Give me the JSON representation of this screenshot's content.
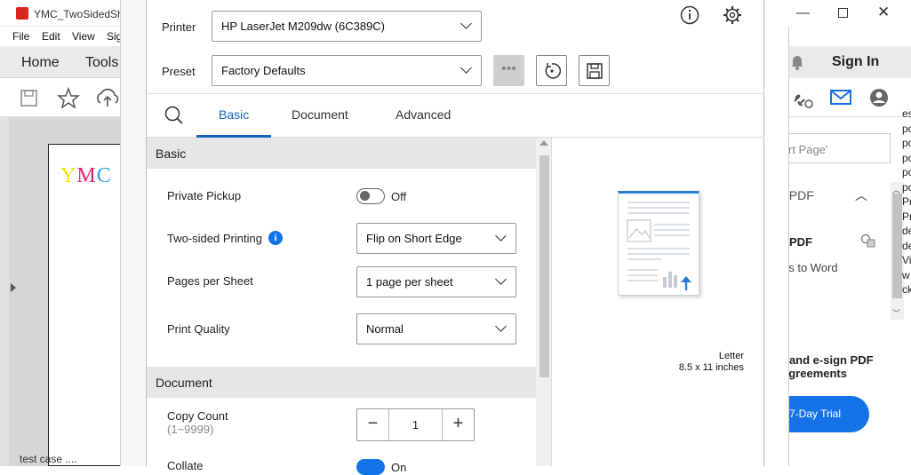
{
  "background_window": {
    "title": "YMC_TwoSidedSho",
    "menu": [
      "File",
      "Edit",
      "View",
      "Sig"
    ],
    "nav": {
      "home": "Home",
      "tools": "Tools"
    },
    "document_text": "YMC",
    "bottom_text": "test case ...."
  },
  "right_pane": {
    "signin": "Sign In",
    "search_placeholder": "rt Page'",
    "section_title": "t PDF",
    "tool_title": "t PDF",
    "tool_desc": "es to Word",
    "promo_line1": "t and e-sign PDF",
    "promo_line2": "agreements",
    "trial_button": "7-Day Trial",
    "list_chars": "es\npo\npo\npo\npo\npo\nPr\nPr\nde\nde\nVi\nw\nck"
  },
  "dialog": {
    "printer_label": "Printer",
    "printer_value": "HP LaserJet M209dw (6C389C)",
    "preset_label": "Preset",
    "preset_value": "Factory Defaults",
    "more_label": "•••",
    "tabs": {
      "basic": "Basic",
      "document": "Document",
      "advanced": "Advanced"
    },
    "basic_section": {
      "title": "Basic",
      "private_pickup": {
        "label": "Private Pickup",
        "state": "Off"
      },
      "two_sided": {
        "label": "Two-sided Printing",
        "value": "Flip on Short Edge"
      },
      "pages_per_sheet": {
        "label": "Pages per Sheet",
        "value": "1 page per sheet"
      },
      "print_quality": {
        "label": "Print Quality",
        "value": "Normal"
      }
    },
    "document_section": {
      "title": "Document",
      "copy_count": {
        "label": "Copy Count",
        "range": "(1~9999)",
        "value": "1"
      },
      "collate": {
        "label": "Collate",
        "state": "On"
      }
    },
    "paper": {
      "name": "Letter",
      "size": "8.5 x 11  inches"
    }
  },
  "colors": {
    "accent": "#1473e6",
    "tab_underline": "#1565c0",
    "y": "#f2e600",
    "m": "#e0246e",
    "c": "#2aa8e6"
  }
}
